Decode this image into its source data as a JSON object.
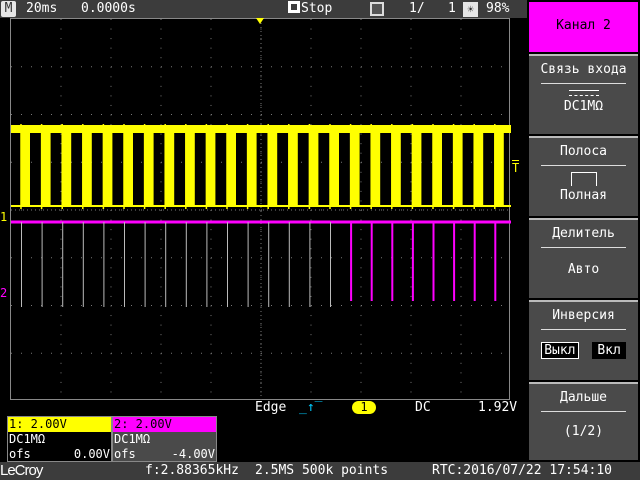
{
  "topbar": {
    "mode_icon": "M",
    "timebase": "20ms",
    "delay": "0.0000s",
    "run_state": "Stop",
    "stop_icon": "stop-square-icon",
    "acq_icon": "stack-icon",
    "acq_count": "1/",
    "acq_total": "1",
    "brightness_icon": "sun-icon",
    "brightness": "98%"
  },
  "trigger": {
    "type": "Edge",
    "slope_icon": "rising-edge-icon",
    "source": "1",
    "coupling": "DC",
    "level": "1.92V",
    "marker": "T"
  },
  "channels": [
    {
      "label": "1: 2.00V",
      "coupling": "DC1MΩ",
      "ofs_label": "ofs",
      "ofs": "0.00V",
      "marker": "1",
      "color": "#ffff00"
    },
    {
      "label": "2: 2.00V",
      "coupling": "DC1MΩ",
      "ofs_label": "ofs",
      "ofs": "-4.00V",
      "marker": "2",
      "color": "#ff00ff"
    }
  ],
  "sidebar": {
    "title": "Канал 2",
    "coupling": {
      "label": "Связь входа",
      "value": "DC1MΩ"
    },
    "bandwidth": {
      "label": "Полоса",
      "value": "Полная"
    },
    "probe": {
      "label": "Делитель",
      "value": "Авто"
    },
    "invert": {
      "label": "Инверсия",
      "off": "Выкл",
      "on": "Вкл"
    },
    "next": {
      "label": "Дальше",
      "value": "(1/2)"
    }
  },
  "status": {
    "brand": "LeCroy",
    "frequency": "f:2.88365kHz",
    "sample_rate": "2.5MS 500k points",
    "rtc": "RTC:2016/07/22 17:54:10"
  }
}
